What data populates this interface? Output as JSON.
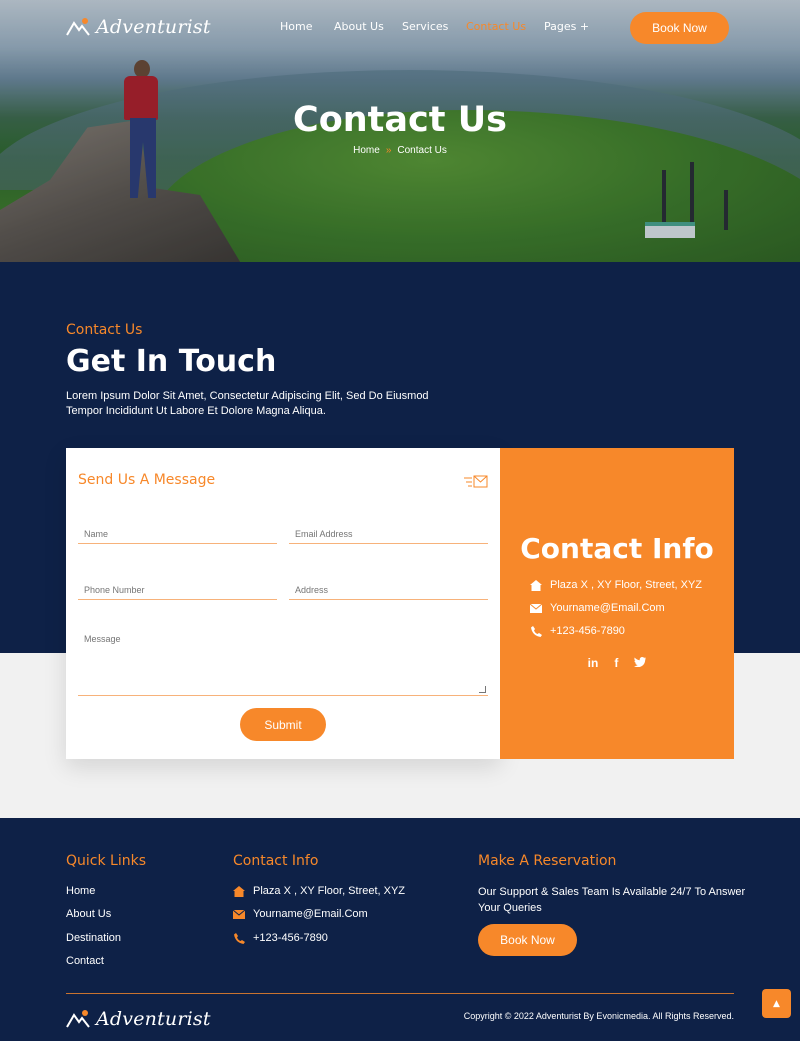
{
  "brand": {
    "name": "Adventurist",
    "accent": "#f7882a",
    "navy": "#0e2147"
  },
  "nav": {
    "links": [
      "Home",
      "About Us",
      "Services",
      "Contact Us",
      "Pages +"
    ],
    "active": "Contact Us",
    "cta": "Book Now"
  },
  "hero": {
    "title": "Contact Us",
    "breadcrumb": {
      "home": "Home",
      "sep": "»",
      "current": "Contact Us"
    }
  },
  "contact": {
    "eyebrow": "Contact Us",
    "heading": "Get In Touch",
    "lede": "Lorem Ipsum Dolor Sit Amet, Consectetur Adipiscing Elit, Sed Do Eiusmod Tempor Incididunt Ut Labore Et Dolore Magna Aliqua.",
    "form": {
      "title": "Send Us A Message",
      "name_placeholder": "Name",
      "email_placeholder": "Email Address",
      "phone_placeholder": "Phone Number",
      "address_placeholder": "Address",
      "message_placeholder": "Message",
      "submit": "Submit"
    },
    "info": {
      "title": "Contact Info",
      "address": "Plaza X , XY Floor, Street, XYZ",
      "email": "Yourname@Email.Com",
      "phone": "+123-456-7890",
      "socials": [
        "in",
        "f",
        "t"
      ]
    }
  },
  "footer": {
    "quick_links_title": "Quick Links",
    "quick_links": [
      "Home",
      "About Us",
      "Destination",
      "Contact"
    ],
    "contact_title": "Contact Info",
    "address": "Plaza X , XY Floor, Street, XYZ",
    "email": "Yourname@Email.Com",
    "phone": "+123-456-7890",
    "reservation_title": "Make A Reservation",
    "reservation_text": "Our Support & Sales Team Is Available 24/7 To Answer Your Queries",
    "reservation_cta": "Book Now",
    "copyright": "Copyright © 2022 Adventurist By Evonicmedia. All Rights Reserved."
  }
}
